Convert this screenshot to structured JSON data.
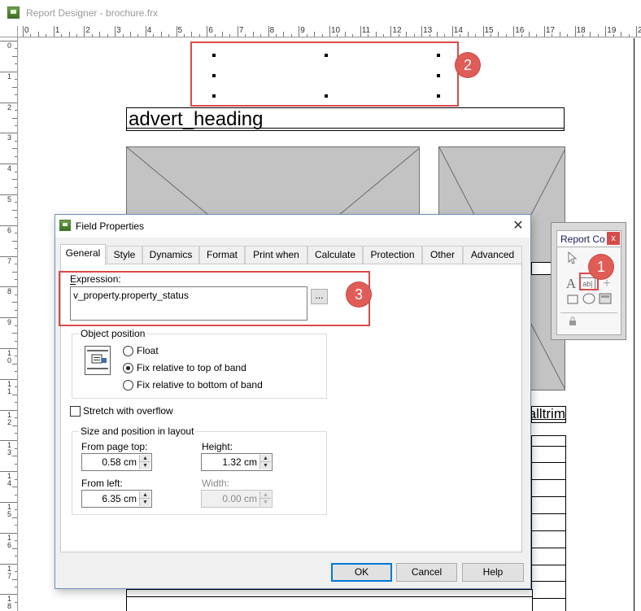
{
  "window": {
    "title": "Report Designer - brochure.frx"
  },
  "ruler": {
    "horizontal_labels": [
      "0",
      "1",
      "2",
      "3",
      "4",
      "5",
      "6",
      "7",
      "8",
      "9",
      "10",
      "11",
      "12",
      "13",
      "14",
      "15",
      "16",
      "17",
      "18",
      "19",
      "2"
    ],
    "vertical_labels": [
      "0",
      "1",
      "2",
      "3",
      "4",
      "5",
      "6",
      "7",
      "8",
      "9",
      "1\n0",
      "1\n1",
      "1\n2",
      "1\n3",
      "1\n4",
      "1\n5",
      "1\n6",
      "1\n7",
      "1\n8"
    ]
  },
  "report": {
    "heading_field": "advert_heading",
    "partial_field": "alltrim"
  },
  "callouts": {
    "one": "1",
    "two": "2",
    "three": "3"
  },
  "report_controls": {
    "title": "Report Co",
    "close": "x"
  },
  "dialog": {
    "title": "Field Properties",
    "close": "✕",
    "tabs": [
      "General",
      "Style",
      "Dynamics",
      "Format",
      "Print when",
      "Calculate",
      "Protection",
      "Other",
      "Advanced"
    ],
    "active_tab": "General",
    "expression_label": "Expression:",
    "expression_value": "v_property.property_status",
    "expression_button": "...",
    "object_position": {
      "title": "Object position",
      "options": [
        "Float",
        "Fix relative to top of band",
        "Fix relative to bottom of band"
      ],
      "selected": "Fix relative to top of band"
    },
    "stretch_label": "Stretch with overflow",
    "stretch_checked": false,
    "size_position": {
      "title": "Size and position in layout",
      "from_page_top_label": "From page top:",
      "from_page_top": "0.58 cm",
      "height_label": "Height:",
      "height": "1.32 cm",
      "from_left_label": "From left:",
      "from_left": "6.35 cm",
      "width_label": "Width:",
      "width": "0.00 cm"
    },
    "buttons": {
      "ok": "OK",
      "cancel": "Cancel",
      "help": "Help"
    }
  },
  "colors": {
    "callout": "#e05c56",
    "highlight": "#d94a4a",
    "placeholder": "#c3c3c3"
  }
}
